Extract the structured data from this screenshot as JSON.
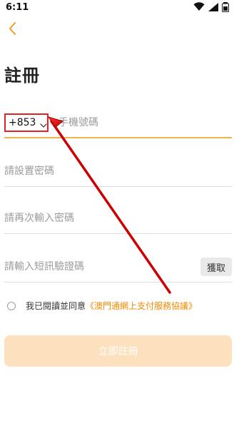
{
  "status_bar": {
    "time": "6:11",
    "icons": [
      "wifi-icon",
      "signal-icon",
      "battery-icon"
    ]
  },
  "page": {
    "title": "註冊"
  },
  "form": {
    "country_code": "+853",
    "phone_placeholder": "手機號碼",
    "password_placeholder": "請設置密碼",
    "confirm_password_placeholder": "請再次輸入密碼",
    "sms_code_placeholder": "請輸入短訊驗證碼",
    "get_code_label": "獲取"
  },
  "agreement": {
    "prefix": "我已閱讀並同意",
    "link": "《澳門通網上支付服務協議》"
  },
  "actions": {
    "register_label": "立即註冊"
  },
  "colors": {
    "accent": "#f08a00",
    "active_line": "#f0b24a",
    "highlight_red": "#e22229",
    "button_bg": "#fde1be"
  }
}
